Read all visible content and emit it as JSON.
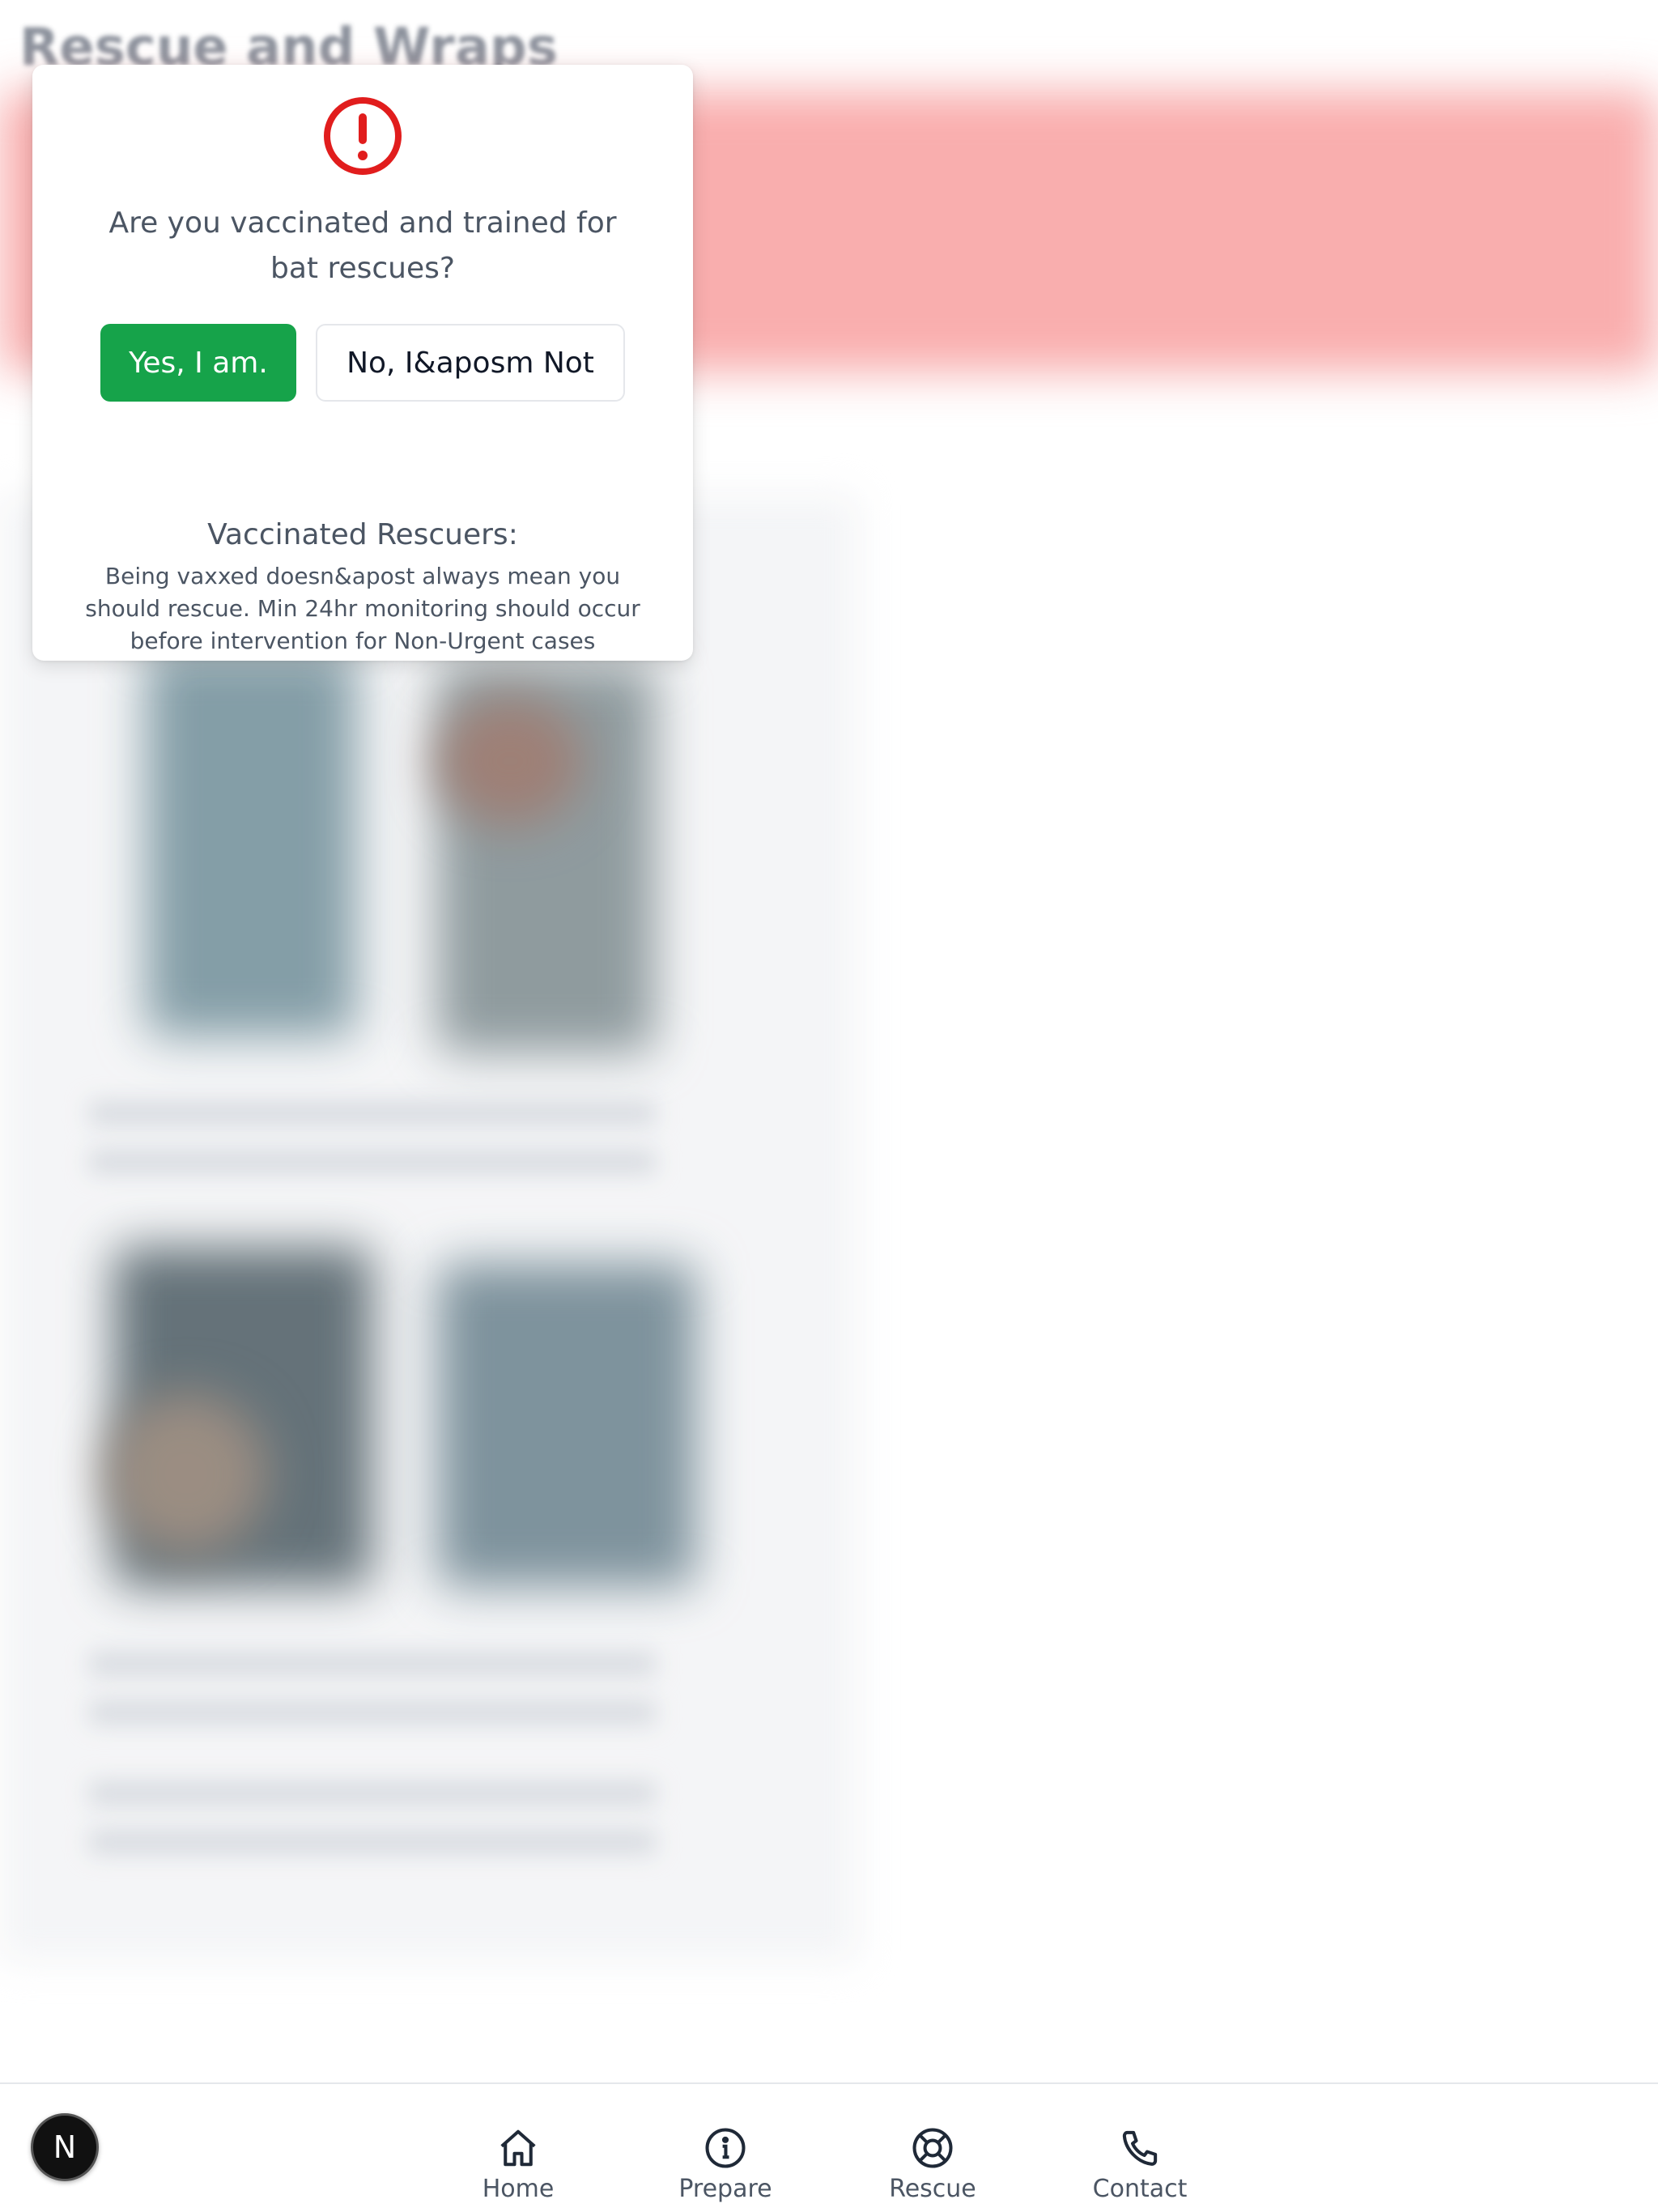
{
  "page": {
    "title": "Rescue and Wraps"
  },
  "modal": {
    "icon": "alert-circle-icon",
    "question": "Are you vaccinated and trained for bat rescues?",
    "yes_label": "Yes, I am.",
    "no_label": "No, I&aposm Not",
    "note_title": "Vaccinated Rescuers:",
    "note_body": "Being vaxxed doesn&apost always mean you should rescue. Min 24hr monitoring should occur before intervention for Non-Urgent cases",
    "colors": {
      "alert": "#e11d1d",
      "yes_button": "#16a34a"
    }
  },
  "nav": {
    "items": [
      {
        "label": "Home",
        "icon": "home-icon"
      },
      {
        "label": "Prepare",
        "icon": "info-icon"
      },
      {
        "label": "Rescue",
        "icon": "lifebuoy-icon"
      },
      {
        "label": "Contact",
        "icon": "phone-icon"
      }
    ],
    "badge": "N"
  }
}
